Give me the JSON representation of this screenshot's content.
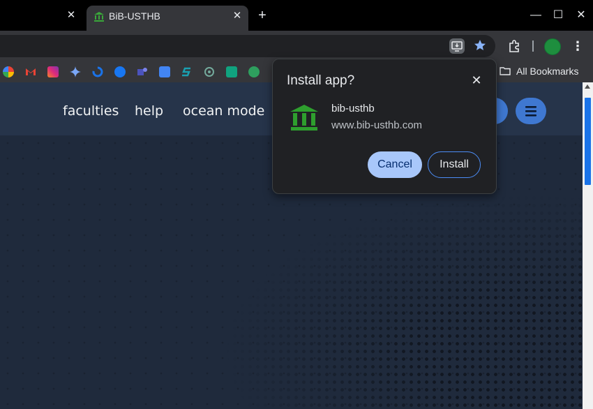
{
  "tabs": {
    "inactive_close": "✕",
    "active_title": "BiB-USTHB",
    "active_close": "✕",
    "new_tab": "+"
  },
  "window": {
    "minimize": "—",
    "maximize": "☐",
    "close": "✕"
  },
  "toolbar": {
    "menu": "⋮"
  },
  "bookmarks": {
    "all_bookmarks_label": "All Bookmarks",
    "items": [
      "photos-icon",
      "gmail-icon",
      "instagram-icon",
      "gemini-icon",
      "dots-icon",
      "facebook-icon",
      "teams-icon",
      "translate-icon",
      "s-icon",
      "chatgpt-icon",
      "p-icon",
      "fi-icon"
    ]
  },
  "page": {
    "nav": {
      "faculties": "faculties",
      "help": "help",
      "ocean_mode": "ocean mode"
    }
  },
  "dialog": {
    "title": "Install app?",
    "close": "✕",
    "app_name": "bib-usthb",
    "app_url": "www.bib-usthb.com",
    "cancel": "Cancel",
    "install": "Install"
  },
  "colors": {
    "accent": "#a8c7fa",
    "page_bg": "#1f2a3c",
    "nav_button": "#3f78d1",
    "app_icon": "#2e9f2e"
  }
}
